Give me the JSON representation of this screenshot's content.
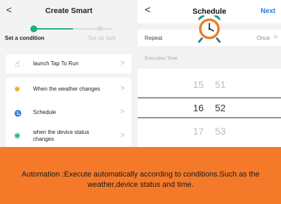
{
  "left": {
    "title": "Create Smart",
    "back_glyph": "<",
    "steps": [
      "Set a condition",
      "Set up task"
    ],
    "items": [
      {
        "label": "launch Tap To Run",
        "icon": "tap-hand-icon"
      },
      {
        "label": "When the weather changes",
        "icon": "sun-icon"
      },
      {
        "label": "Schedule",
        "icon": "clock-icon"
      },
      {
        "label": "when the device status changes",
        "icon": "device-icon"
      }
    ],
    "chevron": ">"
  },
  "right": {
    "title": "Schedule",
    "back_glyph": "<",
    "next_label": "Next",
    "repeat_label": "Repeat",
    "repeat_value": "Once",
    "execution_label": "Execution Time",
    "picker": {
      "rows": [
        {
          "hour": "15",
          "minute": "51"
        },
        {
          "hour": "16",
          "minute": "52"
        },
        {
          "hour": "17",
          "minute": "53"
        }
      ]
    }
  },
  "banner": {
    "text": "Automation :Execute automatically according to conditions.Such as the weather,device status and time."
  },
  "colors": {
    "accent_green": "#1ab07a",
    "link_blue": "#2d7de6",
    "banner_orange": "#f47a2a"
  }
}
